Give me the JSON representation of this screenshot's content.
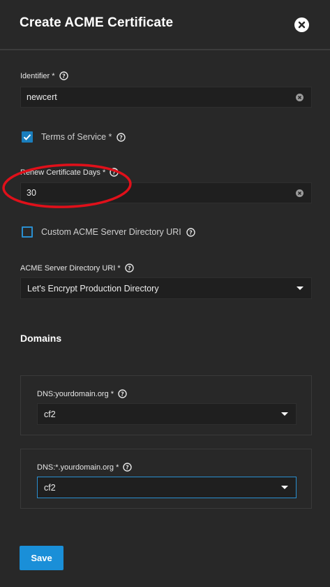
{
  "dialog": {
    "title": "Create ACME Certificate",
    "close_icon": "close-icon"
  },
  "fields": {
    "identifier": {
      "label": "Identifier *",
      "value": "newcert"
    },
    "terms": {
      "label": "Terms of Service *",
      "checked": true
    },
    "renew_days": {
      "label": "Renew Certificate Days *",
      "value": "30"
    },
    "custom_uri": {
      "label": "Custom ACME Server Directory URI",
      "checked": false
    },
    "directory_uri": {
      "label": "ACME Server Directory URI *",
      "selected": "Let's Encrypt Production Directory"
    }
  },
  "domains": {
    "title": "Domains",
    "items": [
      {
        "label": "DNS:yourdomain.org *",
        "selected": "cf2"
      },
      {
        "label": "DNS:*.yourdomain.org *",
        "selected": "cf2"
      }
    ]
  },
  "actions": {
    "save_label": "Save"
  },
  "colors": {
    "background": "#282828",
    "input_bg": "#1f1f1f",
    "accent": "#1a8fd8",
    "annotation": "#e0101a"
  }
}
